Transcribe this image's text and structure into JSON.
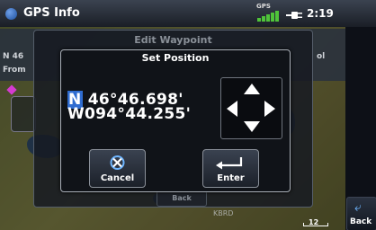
{
  "status_bar": {
    "title": "GPS Info",
    "gps_label": "GPS",
    "time": "2:19",
    "icons": [
      "gps-dot-icon",
      "signal-bars-icon",
      "power-plug-icon"
    ]
  },
  "background": {
    "left_labels": [
      "N 46",
      "From"
    ],
    "right_label": "ol",
    "map_airport": "KBRD",
    "map_scale": "12",
    "back_label": "Back"
  },
  "edit_waypoint": {
    "title": "Edit Waypoint",
    "back_label": "Back"
  },
  "set_position": {
    "title": "Set Position",
    "latitude_hemisphere": "N",
    "latitude_value": " 46°46.698'",
    "longitude_value": "W094°44.255'",
    "dpad_icon": "four-way-arrows-icon",
    "cancel_label": "Cancel",
    "cancel_icon": "cancel-x-icon",
    "enter_label": "Enter",
    "enter_icon": "enter-return-icon"
  },
  "sidebar": {
    "back_label": "Back",
    "back_icon": "back-return-icon"
  },
  "colors": {
    "cursor_highlight": "#2f6cd0",
    "map_green": "#8b8b4c",
    "waypoint_magenta": "#d53bd0"
  }
}
